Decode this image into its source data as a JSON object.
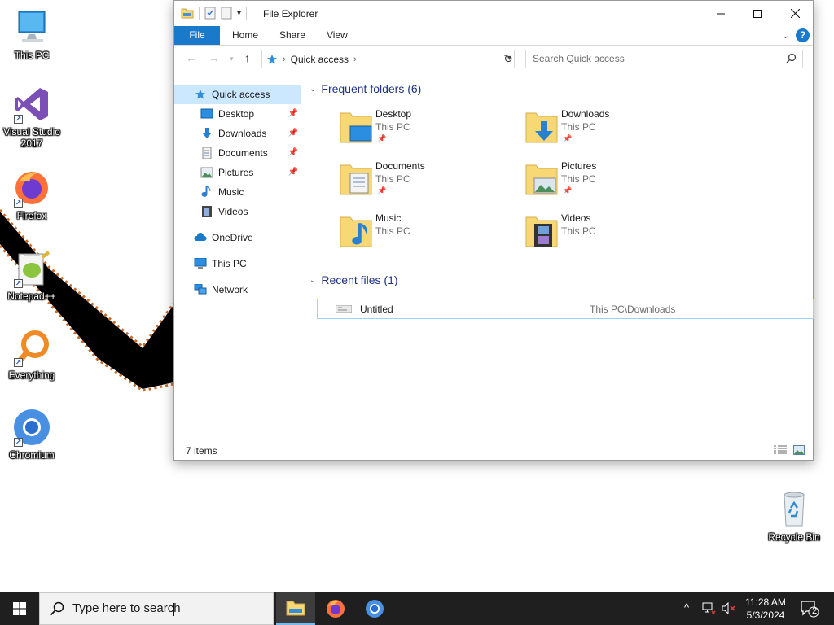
{
  "desktop": {
    "icons": [
      {
        "label": "This PC"
      },
      {
        "label": "Visual Studio 2017"
      },
      {
        "label": "Firefox"
      },
      {
        "label": "Notepad++"
      },
      {
        "label": "Everything"
      },
      {
        "label": "Chromium"
      },
      {
        "label": "Recycle Bin"
      }
    ]
  },
  "window": {
    "title": "File Explorer",
    "ribbon_tabs": [
      "File",
      "Home",
      "Share",
      "View"
    ],
    "help_label": "?",
    "address": {
      "crumb": "Quick access"
    },
    "search_placeholder": "Search Quick access",
    "nav_pane": {
      "quick_access": "Quick access",
      "pinned": [
        "Desktop",
        "Downloads",
        "Documents",
        "Pictures"
      ],
      "unpinned": [
        "Music",
        "Videos"
      ],
      "onedrive": "OneDrive",
      "this_pc": "This PC",
      "network": "Network"
    },
    "frequent_header": "Frequent folders (6)",
    "folders": [
      {
        "name": "Desktop",
        "location": "This PC"
      },
      {
        "name": "Downloads",
        "location": "This PC"
      },
      {
        "name": "Documents",
        "location": "This PC"
      },
      {
        "name": "Pictures",
        "location": "This PC"
      },
      {
        "name": "Music",
        "location": "This PC"
      },
      {
        "name": "Videos",
        "location": "This PC"
      }
    ],
    "recent_header": "Recent files (1)",
    "recent_files": [
      {
        "name": "Untitled",
        "path": "This PC\\Downloads"
      }
    ],
    "status": "7 items"
  },
  "taskbar": {
    "search_placeholder": "Type here to search",
    "clock_time": "11:28 AM",
    "clock_date": "5/3/2024",
    "notification_count": "2"
  },
  "colors": {
    "accent": "#1979ca",
    "selection": "#cce8ff",
    "folder": "#f8d775",
    "taskbar": "#1f1f1f"
  }
}
